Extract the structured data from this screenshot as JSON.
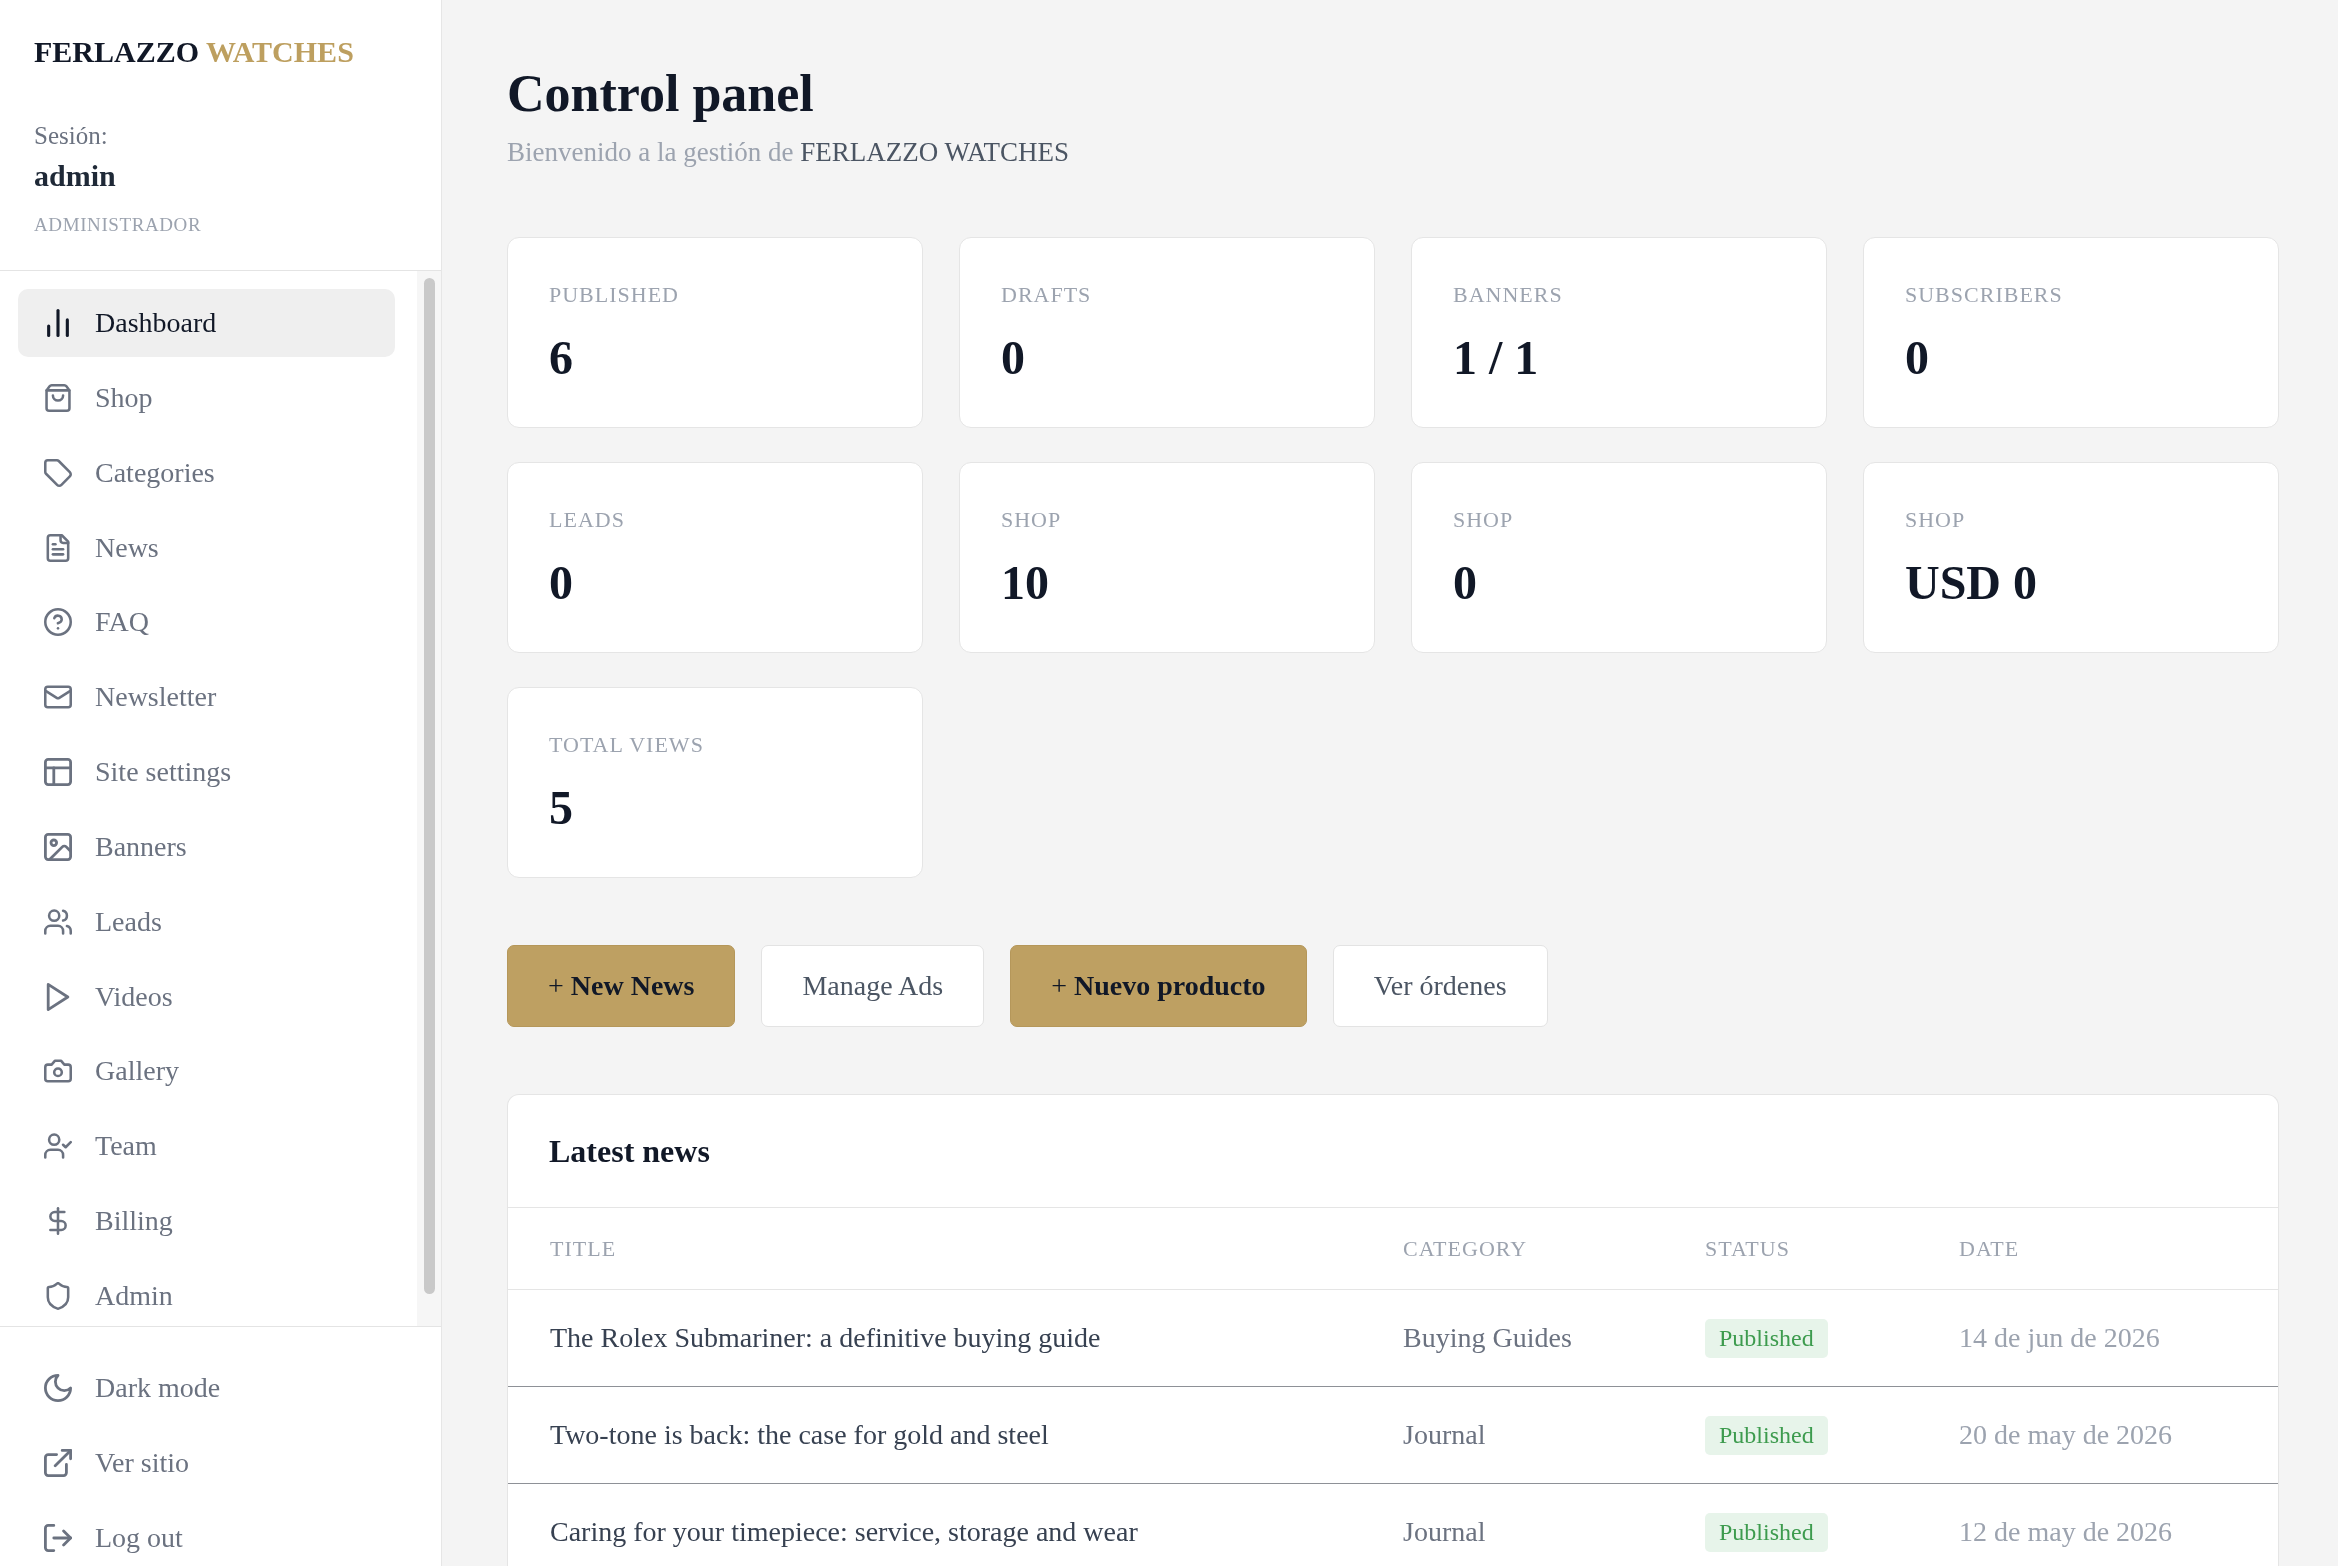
{
  "sidebar": {
    "logo": {
      "name": "FERLAZZO",
      "accent": "WATCHES"
    },
    "session": {
      "label": "Sesión:",
      "user": "admin",
      "role": "ADMINISTRADOR"
    },
    "nav": [
      {
        "label": "Dashboard",
        "selected": true
      },
      {
        "label": "Shop",
        "selected": false
      },
      {
        "label": "Categories",
        "selected": false
      },
      {
        "label": "News",
        "selected": false
      },
      {
        "label": "FAQ",
        "selected": false
      },
      {
        "label": "Newsletter",
        "selected": false
      },
      {
        "label": "Site settings",
        "selected": false
      },
      {
        "label": "Banners",
        "selected": false
      },
      {
        "label": "Leads",
        "selected": false
      },
      {
        "label": "Videos",
        "selected": false
      },
      {
        "label": "Gallery",
        "selected": false
      },
      {
        "label": "Team",
        "selected": false
      },
      {
        "label": "Billing",
        "selected": false
      },
      {
        "label": "Admin",
        "selected": false
      }
    ],
    "footer_links": [
      "Dark mode",
      "Ver sitio",
      "Log out"
    ]
  },
  "header": {
    "title": "Control panel",
    "subtitle": "Bienvenido a la gestión de",
    "brand": "FERLAZZO WATCHES"
  },
  "stats": [
    {
      "label": "PUBLISHED",
      "value": "6"
    },
    {
      "label": "DRAFTS",
      "value": "0"
    },
    {
      "label": "BANNERS",
      "value": "1 / 1"
    },
    {
      "label": "SUBSCRIBERS",
      "value": "0"
    },
    {
      "label": "LEADS",
      "value": "0"
    },
    {
      "label": "SHOP",
      "value": "10"
    },
    {
      "label": "SHOP",
      "value": "0"
    },
    {
      "label": "SHOP",
      "value": "USD 0"
    },
    {
      "label": "TOTAL VIEWS",
      "value": "5"
    }
  ],
  "actions": [
    {
      "label": "+ **New News**",
      "kind": "primary"
    },
    {
      "label": "Manage Ads",
      "kind": "secondary"
    },
    {
      "label": "+ **Nuevo producto**",
      "kind": "primary"
    },
    {
      "label": "Ver órdenes",
      "kind": "secondary"
    }
  ],
  "latest_news": {
    "title": "Latest news",
    "columns": [
      "TITLE",
      "CATEGORY",
      "STATUS",
      "DATE"
    ],
    "rows": [
      {
        "title": "The Rolex Submariner: a definitive buying guide",
        "category": "Buying Guides",
        "status": "Published",
        "date": "14 de jun de 2026"
      },
      {
        "title": "Two-tone is back: the case for gold and steel",
        "category": "Journal",
        "status": "Published",
        "date": "20 de may de 2026"
      },
      {
        "title": "Caring for your timepiece: service, storage and wear",
        "category": "Journal",
        "status": "Published",
        "date": "12 de may de 2026"
      }
    ]
  }
}
